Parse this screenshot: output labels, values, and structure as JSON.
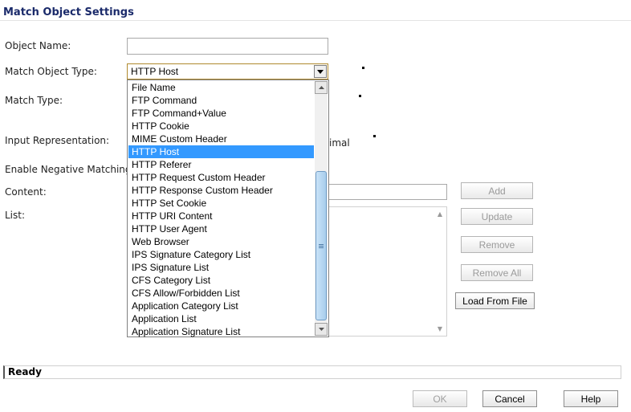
{
  "header": {
    "title": "Match Object Settings"
  },
  "form": {
    "object_name_label": "Object Name:",
    "object_name_value": "",
    "match_object_type_label": "Match Object Type:",
    "match_object_type_value": "HTTP Host",
    "match_type_label": "Match Type:",
    "input_representation_label": "Input Representation:",
    "input_representation_partial": "imal",
    "enable_negative_matching_label": "Enable Negative Matching:",
    "content_label": "Content:",
    "content_value": "",
    "list_label": "List:"
  },
  "dropdown": {
    "selected": "HTTP Host",
    "options": [
      "File Name",
      "FTP Command",
      "FTP Command+Value",
      "HTTP Cookie",
      "MIME Custom Header",
      "HTTP Host",
      "HTTP Referer",
      "HTTP Request Custom Header",
      "HTTP Response Custom Header",
      "HTTP Set Cookie",
      "HTTP URI Content",
      "HTTP User Agent",
      "Web Browser",
      "IPS Signature Category List",
      "IPS Signature List",
      "CFS Category List",
      "CFS Allow/Forbidden List",
      "Application Category List",
      "Application List",
      "Application Signature List"
    ]
  },
  "buttons": {
    "add": "Add",
    "update": "Update",
    "remove": "Remove",
    "remove_all": "Remove All",
    "load_from_file": "Load From File"
  },
  "status": {
    "text": "Ready"
  },
  "footer": {
    "ok": "OK",
    "cancel": "Cancel",
    "help": "Help"
  },
  "colors": {
    "selection": "#3399ff",
    "title": "#1a2a6a"
  }
}
